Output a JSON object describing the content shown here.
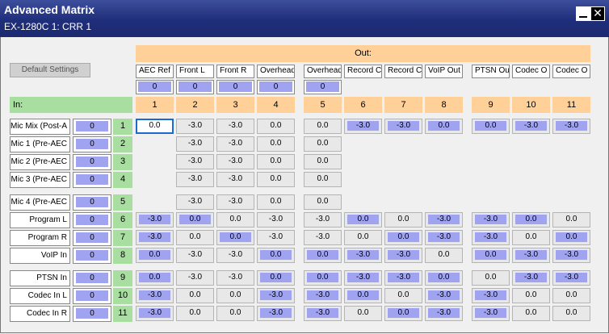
{
  "window": {
    "title": "Advanced Matrix",
    "subtitle": "EX-1280C 1: CRR 1",
    "minimize_icon": "minimize-icon",
    "close_icon": "close-icon",
    "close_glyph": "✕"
  },
  "default_settings_label": "Default Settings",
  "out_header": "Out:",
  "in_header": "In:",
  "colors": {
    "accent_blue": "#a0a4f0",
    "out_orange": "#ffd098",
    "in_green": "#a8dfa0",
    "titlebar": "#1f2e7a",
    "selected_border": "#1a6ad0"
  },
  "outputs": [
    {
      "label": "AEC Ref",
      "value": "0",
      "channel": "1"
    },
    {
      "label": "Front L",
      "value": "0",
      "channel": "2"
    },
    {
      "label": "Front R",
      "value": "0",
      "channel": "3"
    },
    {
      "label": "Overhead",
      "value": "0",
      "channel": "4"
    },
    {
      "label": "Overhead",
      "value": "0",
      "channel": "5"
    },
    {
      "label": "Record C",
      "value": "",
      "channel": "6"
    },
    {
      "label": "Record C",
      "value": "",
      "channel": "7"
    },
    {
      "label": "VoIP Out",
      "value": "",
      "channel": "8"
    },
    {
      "label": "PTSN Out",
      "value": "",
      "channel": "9"
    },
    {
      "label": "Codec O",
      "value": "",
      "channel": "10"
    },
    {
      "label": "Codec O",
      "value": "",
      "channel": "11"
    }
  ],
  "inputs": [
    {
      "label": "Mic Mix (Post-A",
      "value": "0",
      "channel": "1",
      "cells": [
        {
          "v": "0.0",
          "on": false,
          "sel": true
        },
        {
          "v": "-3.0",
          "on": false
        },
        {
          "v": "-3.0",
          "on": false
        },
        {
          "v": "0.0",
          "on": false
        },
        {
          "v": "0.0",
          "on": false
        },
        {
          "v": "-3.0",
          "on": true
        },
        {
          "v": "-3.0",
          "on": true
        },
        {
          "v": "0.0",
          "on": true
        },
        {
          "v": "0.0",
          "on": true
        },
        {
          "v": "-3.0",
          "on": true
        },
        {
          "v": "-3.0",
          "on": true
        }
      ]
    },
    {
      "label": "Mic 1 (Pre-AEC",
      "value": "0",
      "channel": "2",
      "cells": [
        null,
        {
          "v": "-3.0",
          "on": false
        },
        {
          "v": "-3.0",
          "on": false
        },
        {
          "v": "0.0",
          "on": false
        },
        {
          "v": "0.0",
          "on": false
        },
        null,
        null,
        null,
        null,
        null,
        null
      ]
    },
    {
      "label": "Mic 2 (Pre-AEC",
      "value": "0",
      "channel": "3",
      "cells": [
        null,
        {
          "v": "-3.0",
          "on": false
        },
        {
          "v": "-3.0",
          "on": false
        },
        {
          "v": "0.0",
          "on": false
        },
        {
          "v": "0.0",
          "on": false
        },
        null,
        null,
        null,
        null,
        null,
        null
      ]
    },
    {
      "label": "Mic 3 (Pre-AEC",
      "value": "0",
      "channel": "4",
      "cells": [
        null,
        {
          "v": "-3.0",
          "on": false
        },
        {
          "v": "-3.0",
          "on": false
        },
        {
          "v": "0.0",
          "on": false
        },
        {
          "v": "0.0",
          "on": false
        },
        null,
        null,
        null,
        null,
        null,
        null
      ]
    },
    {
      "label": "Mic 4 (Pre-AEC",
      "value": "0",
      "channel": "5",
      "cells": [
        null,
        {
          "v": "-3.0",
          "on": false
        },
        {
          "v": "-3.0",
          "on": false
        },
        {
          "v": "0.0",
          "on": false
        },
        {
          "v": "0.0",
          "on": false
        },
        null,
        null,
        null,
        null,
        null,
        null
      ]
    },
    {
      "label": "Program L",
      "value": "0",
      "channel": "6",
      "cells": [
        {
          "v": "-3.0",
          "on": true
        },
        {
          "v": "0.0",
          "on": true
        },
        {
          "v": "0.0",
          "on": false
        },
        {
          "v": "-3.0",
          "on": false
        },
        {
          "v": "-3.0",
          "on": false
        },
        {
          "v": "0.0",
          "on": true
        },
        {
          "v": "0.0",
          "on": false
        },
        {
          "v": "-3.0",
          "on": true
        },
        {
          "v": "-3.0",
          "on": true
        },
        {
          "v": "0.0",
          "on": true
        },
        {
          "v": "0.0",
          "on": false
        }
      ]
    },
    {
      "label": "Program R",
      "value": "0",
      "channel": "7",
      "cells": [
        {
          "v": "-3.0",
          "on": true
        },
        {
          "v": "0.0",
          "on": false
        },
        {
          "v": "0.0",
          "on": true
        },
        {
          "v": "-3.0",
          "on": false
        },
        {
          "v": "-3.0",
          "on": false
        },
        {
          "v": "0.0",
          "on": false
        },
        {
          "v": "0.0",
          "on": true
        },
        {
          "v": "-3.0",
          "on": true
        },
        {
          "v": "-3.0",
          "on": true
        },
        {
          "v": "0.0",
          "on": false
        },
        {
          "v": "0.0",
          "on": true
        }
      ]
    },
    {
      "label": "VoIP In",
      "value": "0",
      "channel": "8",
      "cells": [
        {
          "v": "0.0",
          "on": true
        },
        {
          "v": "-3.0",
          "on": false
        },
        {
          "v": "-3.0",
          "on": false
        },
        {
          "v": "0.0",
          "on": true
        },
        {
          "v": "0.0",
          "on": true
        },
        {
          "v": "-3.0",
          "on": true
        },
        {
          "v": "-3.0",
          "on": true
        },
        {
          "v": "0.0",
          "on": false
        },
        {
          "v": "0.0",
          "on": true
        },
        {
          "v": "-3.0",
          "on": true
        },
        {
          "v": "-3.0",
          "on": true
        }
      ]
    },
    {
      "label": "PTSN In",
      "value": "0",
      "channel": "9",
      "cells": [
        {
          "v": "0.0",
          "on": true
        },
        {
          "v": "-3.0",
          "on": false
        },
        {
          "v": "-3.0",
          "on": false
        },
        {
          "v": "0.0",
          "on": true
        },
        {
          "v": "0.0",
          "on": true
        },
        {
          "v": "-3.0",
          "on": true
        },
        {
          "v": "-3.0",
          "on": true
        },
        {
          "v": "0.0",
          "on": true
        },
        {
          "v": "0.0",
          "on": false
        },
        {
          "v": "-3.0",
          "on": true
        },
        {
          "v": "-3.0",
          "on": true
        }
      ]
    },
    {
      "label": "Codec In L",
      "value": "0",
      "channel": "10",
      "cells": [
        {
          "v": "-3.0",
          "on": true
        },
        {
          "v": "0.0",
          "on": false
        },
        {
          "v": "0.0",
          "on": false
        },
        {
          "v": "-3.0",
          "on": true
        },
        {
          "v": "-3.0",
          "on": true
        },
        {
          "v": "0.0",
          "on": true
        },
        {
          "v": "0.0",
          "on": false
        },
        {
          "v": "-3.0",
          "on": true
        },
        {
          "v": "-3.0",
          "on": true
        },
        {
          "v": "0.0",
          "on": false
        },
        {
          "v": "0.0",
          "on": false
        }
      ]
    },
    {
      "label": "Codec In R",
      "value": "0",
      "channel": "11",
      "cells": [
        {
          "v": "-3.0",
          "on": true
        },
        {
          "v": "0.0",
          "on": false
        },
        {
          "v": "0.0",
          "on": false
        },
        {
          "v": "-3.0",
          "on": true
        },
        {
          "v": "-3.0",
          "on": true
        },
        {
          "v": "0.0",
          "on": false
        },
        {
          "v": "0.0",
          "on": true
        },
        {
          "v": "-3.0",
          "on": true
        },
        {
          "v": "-3.0",
          "on": true
        },
        {
          "v": "0.0",
          "on": false
        },
        {
          "v": "0.0",
          "on": false
        }
      ]
    }
  ]
}
